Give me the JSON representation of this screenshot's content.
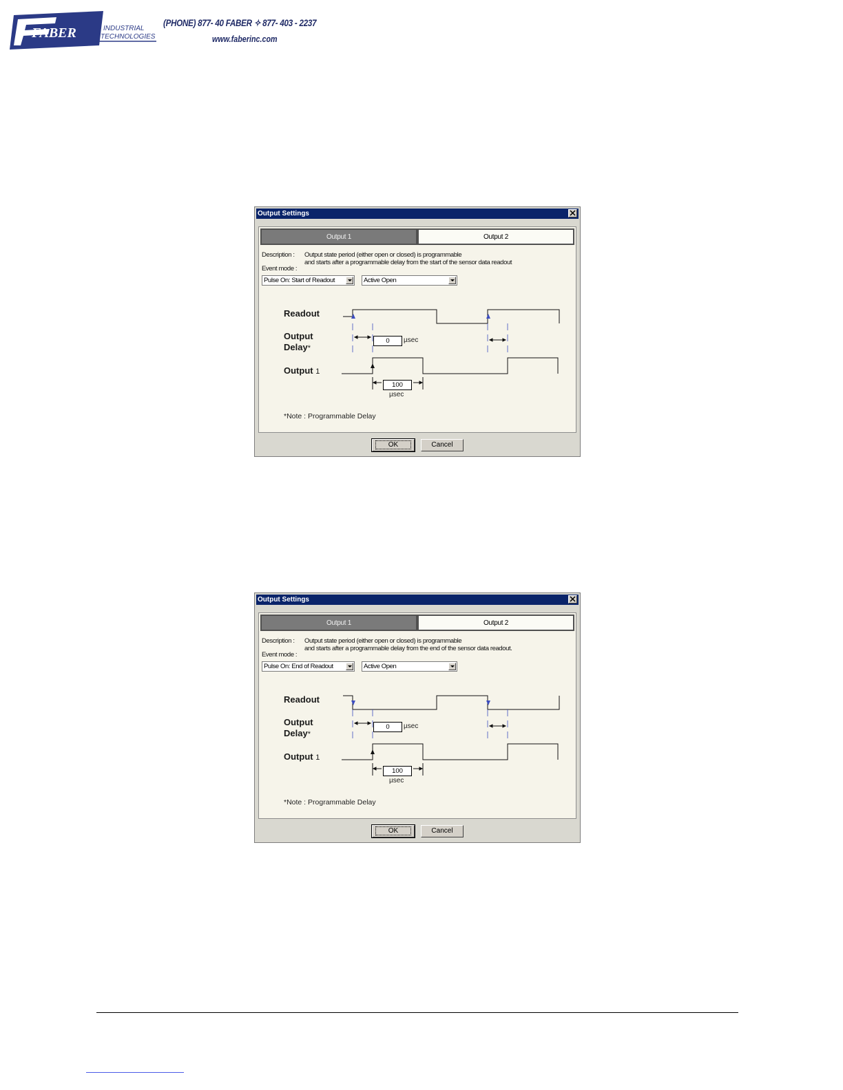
{
  "header": {
    "logo_word": "FABER",
    "logo_sub1": "INDUSTRIAL",
    "logo_sub2": "TECHNOLOGIES",
    "phone": "(PHONE) 877- 40 FABER  ✧  877- 403 - 2237",
    "website": "www.faberinc.com",
    "brand_color": "#1f2a66"
  },
  "dialogs": [
    {
      "title": "Output Settings",
      "tabs": [
        "Output 1",
        "Output 2"
      ],
      "description_label": "Description :",
      "description_line1": "Output state period (either open or closed) is programmable",
      "description_line2": "and starts after a programmable delay from the start of the sensor data readout",
      "event_mode_label": "Event mode :",
      "event_mode_value": "Pulse On: Start of Readout",
      "polarity_value": "Active Open",
      "signal_readout": "Readout",
      "signal_delay_1": "Output",
      "signal_delay_2": "Delay",
      "signal_delay_mark": "*",
      "signal_output": "Output",
      "signal_output_num": "1",
      "delay_value": "0",
      "delay_unit": "µsec",
      "width_value": "100",
      "width_unit": "µsec",
      "note": "*Note : Programmable Delay",
      "ok_label": "OK",
      "cancel_label": "Cancel"
    },
    {
      "title": "Output Settings",
      "tabs": [
        "Output 1",
        "Output 2"
      ],
      "description_label": "Description :",
      "description_line1": "Output state period (either open or closed) is programmable",
      "description_line2": "and starts after a programmable delay from the end of the sensor data readout.",
      "event_mode_label": "Event mode :",
      "event_mode_value": "Pulse On: End of Readout",
      "polarity_value": "Active Open",
      "signal_readout": "Readout",
      "signal_delay_1": "Output",
      "signal_delay_2": "Delay",
      "signal_delay_mark": "*",
      "signal_output": "Output",
      "signal_output_num": "1",
      "delay_value": "0",
      "delay_unit": "µsec",
      "width_value": "100",
      "width_unit": "µsec",
      "note": "*Note : Programmable Delay",
      "ok_label": "OK",
      "cancel_label": "Cancel"
    }
  ]
}
